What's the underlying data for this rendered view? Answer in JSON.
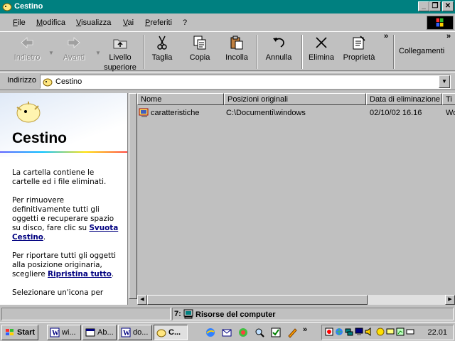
{
  "window": {
    "title": "Cestino",
    "controls": {
      "minimize": "_",
      "maximize": "❐",
      "close": "✕"
    }
  },
  "menu": [
    "File",
    "Modifica",
    "Visualizza",
    "Vai",
    "Preferiti",
    "?"
  ],
  "toolbar": {
    "back": "Indietro",
    "forward": "Avanti",
    "up_line1": "Livello",
    "up_line2": "superiore",
    "cut": "Taglia",
    "copy": "Copia",
    "paste": "Incolla",
    "undo": "Annulla",
    "delete": "Elimina",
    "properties": "Proprietà",
    "more": "»",
    "links": "Collegamenti",
    "links_more": "»"
  },
  "address": {
    "label": "Indirizzo",
    "value": "Cestino"
  },
  "left_panel": {
    "title": "Cestino",
    "para1": "La cartella contiene le cartelle ed i file eliminati.",
    "para2_text": "Per rimuovere definitivamente tutti gli oggetti e recuperare spazio su disco, fare clic su ",
    "para2_link": "Svuota Cestino",
    "para2_end": ".",
    "para3_text": "Per riportare tutti gli oggetti alla posizione originaria, scegliere ",
    "para3_link": "Ripristina tutto",
    "para3_end": ".",
    "para4": "Selezionare un'icona per"
  },
  "list": {
    "columns": [
      "Nome",
      "Posizioni originali",
      "Data di eliminazione",
      "Ti"
    ],
    "rows": [
      {
        "name": "caratteristiche",
        "location": "C:\\Documenti\\windows",
        "date": "02/10/02 16.16",
        "type": "Wo"
      }
    ]
  },
  "status": {
    "count": "7:",
    "zone": "Risorse del computer"
  },
  "taskbar": {
    "start": "Start",
    "tasks": [
      "wi...",
      "Ab...",
      "do...",
      "C..."
    ],
    "clock": "22.01"
  },
  "colors": {
    "titlebar": "#008080",
    "face": "#c0c0c0",
    "link": "#000080"
  }
}
